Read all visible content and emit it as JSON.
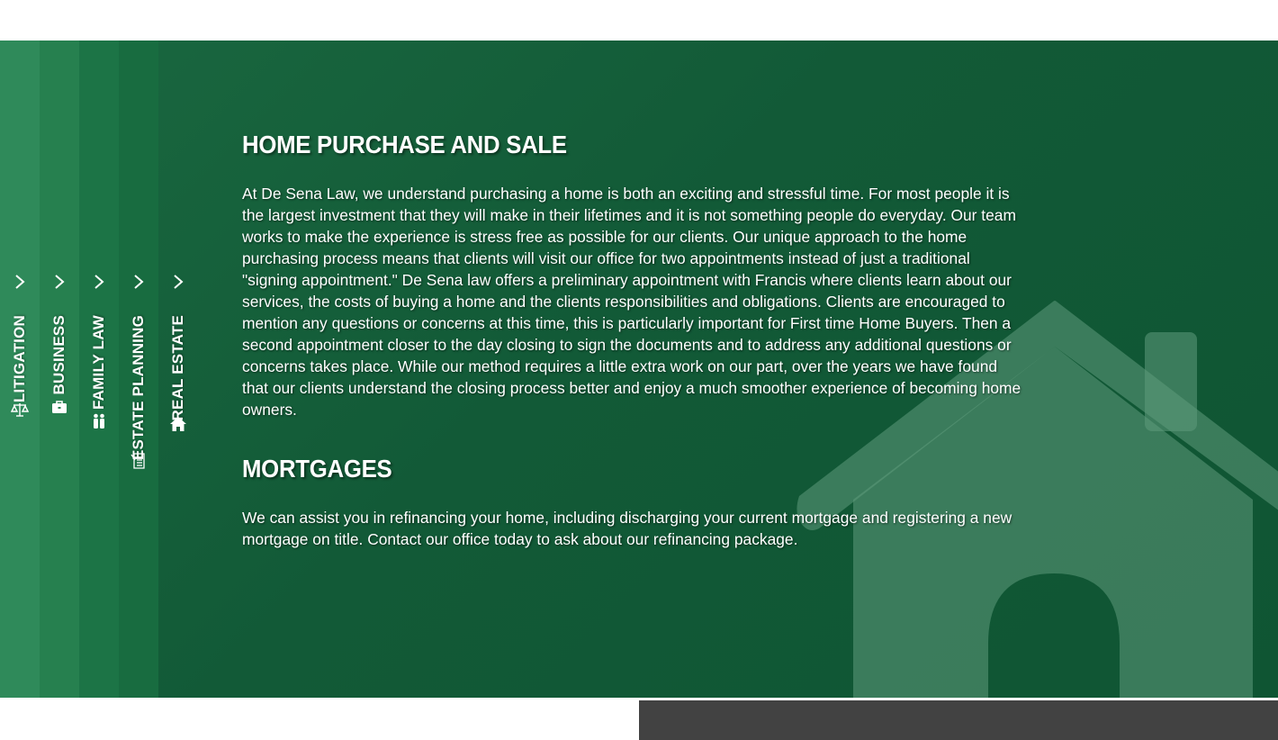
{
  "colors": {
    "panel": "#125a37",
    "tab_litigation": "#2f8a5a",
    "tab_business": "#26804f",
    "tab_family": "#1c7446",
    "tab_estate": "#186c40",
    "footer_dark": "#424242"
  },
  "sidebar": {
    "tabs": [
      {
        "label": "LITIGATION",
        "icon": "scales-icon"
      },
      {
        "label": "BUSINESS",
        "icon": "briefcase-icon"
      },
      {
        "label": "FAMILY LAW",
        "icon": "family-icon"
      },
      {
        "label": "ESTATE PLANNING",
        "icon": "document-icon"
      },
      {
        "label": "REAL ESTATE",
        "icon": "home-icon"
      }
    ]
  },
  "content": {
    "home_purchase": {
      "title": "HOME PURCHASE AND SALE",
      "body": "At De Sena Law, we understand purchasing a home is both an exciting and stressful time. For most people it is the largest investment that they will make in their lifetimes and it is not something people do everyday. Our team works to make the experience is stress free as possible for our clients. Our unique approach to the home purchasing process means that clients will visit our office for two appointments instead of just a traditional \"signing appointment.\" De Sena law offers a preliminary appointment with Francis where clients learn about our services, the costs of buying a home and the clients responsibilities and obligations. Clients are encouraged to mention any questions or concerns at this time, this is particularly important for First time Home Buyers. Then a second appointment closer to the day closing to sign the documents and to address any additional questions or concerns takes place. While our method requires a little extra work on our part, over the years we have found that our clients understand the closing process better and enjoy a much smoother experience of becoming home owners."
    },
    "mortgages": {
      "title": "MORTGAGES",
      "body": "We can assist you in refinancing your home, including discharging your current mortgage and registering a new mortgage on title. Contact our office today to ask about our refinancing package."
    }
  }
}
